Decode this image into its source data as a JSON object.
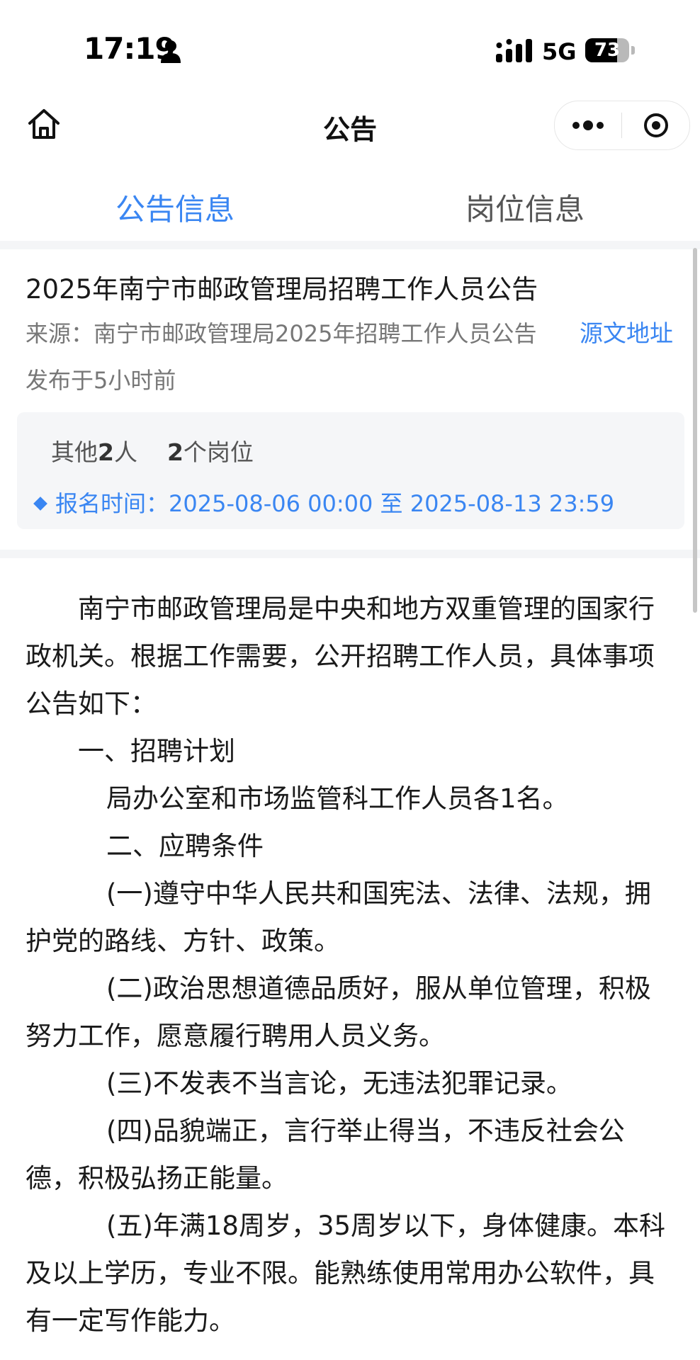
{
  "status_bar": {
    "time": "17:19",
    "network": "5G",
    "battery": "73",
    "battery_level": 0.73
  },
  "nav": {
    "title": "公告"
  },
  "tabs": [
    {
      "label": "公告信息",
      "active": true
    },
    {
      "label": "岗位信息",
      "active": false
    }
  ],
  "notice": {
    "title": "2025年南宁市邮政管理局招聘工作人员公告",
    "source": "来源：南宁市邮政管理局2025年招聘工作人员公告",
    "source_link": "源文地址",
    "published": "发布于5小时前",
    "others_prefix": "其他",
    "others_count": "2",
    "others_suffix": "人",
    "positions_count": "2",
    "positions_suffix": "个岗位",
    "registration": "报名时间：2025-08-06 00:00 至 2025-08-13 23:59"
  },
  "article": {
    "lines": [
      "南宁市邮政管理局是中央和地方双重管理的国家行",
      "政机关。根据工作需要，公开招聘工作人员，具体事项",
      "公告如下：",
      "一、招聘计划",
      "局办公室和市场监管科工作人员各1名。",
      "二、应聘条件",
      "(一)遵守中华人民共和国宪法、法律、法规，拥",
      "护党的路线、方针、政策。",
      "(二)政治思想道德品质好，服从单位管理，积极",
      "努力工作，愿意履行聘用人员义务。",
      "(三)不发表不当言论，无违法犯罪记录。",
      "(四)品貌端正，言行举止得当，不违反社会公",
      "德，积极弘扬正能量。",
      "(五)年满18周岁，35周岁以下，身体健康。本科",
      "及以上学历，专业不限。能熟练使用常用办公软件，具",
      "有一定写作能力。"
    ]
  },
  "colors": {
    "accent": "#3a86f2",
    "muted_text": "#777777",
    "card_bg": "#f5f6f8"
  },
  "icons": [
    "person-icon",
    "signal-icon",
    "battery-icon",
    "home-icon",
    "more-icon",
    "close-target-icon",
    "diamond-icon"
  ]
}
